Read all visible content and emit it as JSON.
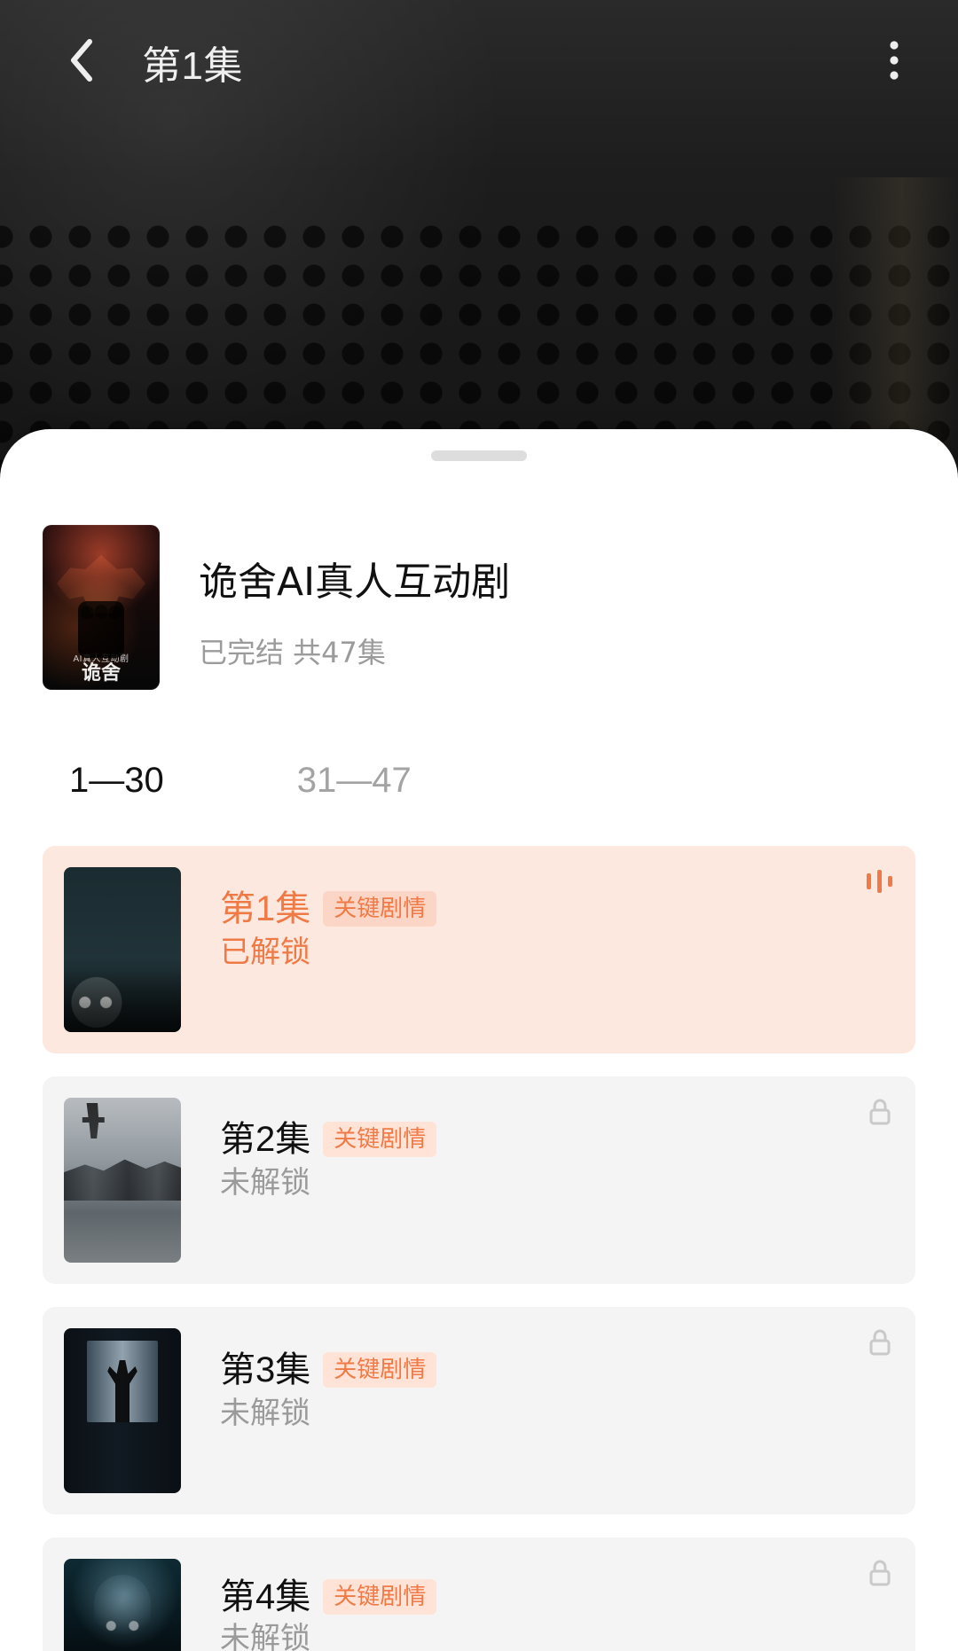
{
  "top_bar": {
    "episode_title": "第1集",
    "icons": {
      "back": "back-chevron-icon",
      "more": "more-vertical-icon"
    }
  },
  "series": {
    "title": "诡舍AI真人互动剧",
    "meta": "已完结 共47集",
    "cover": {
      "caption": "AI真人互动剧",
      "title": "诡舍"
    }
  },
  "ranges": {
    "tabs": [
      {
        "label": "1—30",
        "active": true
      },
      {
        "label": "31—47",
        "active": false
      }
    ]
  },
  "episodes": [
    {
      "title": "第1集",
      "tag": "关键剧情",
      "status": "已解锁",
      "state": "playing",
      "corner_icon": "playing-indicator-icon"
    },
    {
      "title": "第2集",
      "tag": "关键剧情",
      "status": "未解锁",
      "state": "locked",
      "corner_icon": "lock-icon"
    },
    {
      "title": "第3集",
      "tag": "关键剧情",
      "status": "未解锁",
      "state": "locked",
      "corner_icon": "lock-icon"
    },
    {
      "title": "第4集",
      "tag": "关键剧情",
      "status": "未解锁",
      "state": "locked",
      "corner_icon": "lock-icon"
    }
  ],
  "colors": {
    "accent": "#f07a46",
    "active_card_bg": "#fde8df",
    "card_bg": "#f4f4f4",
    "tag_bg": "#ffe3d6",
    "muted_text": "#9a9a9a"
  }
}
